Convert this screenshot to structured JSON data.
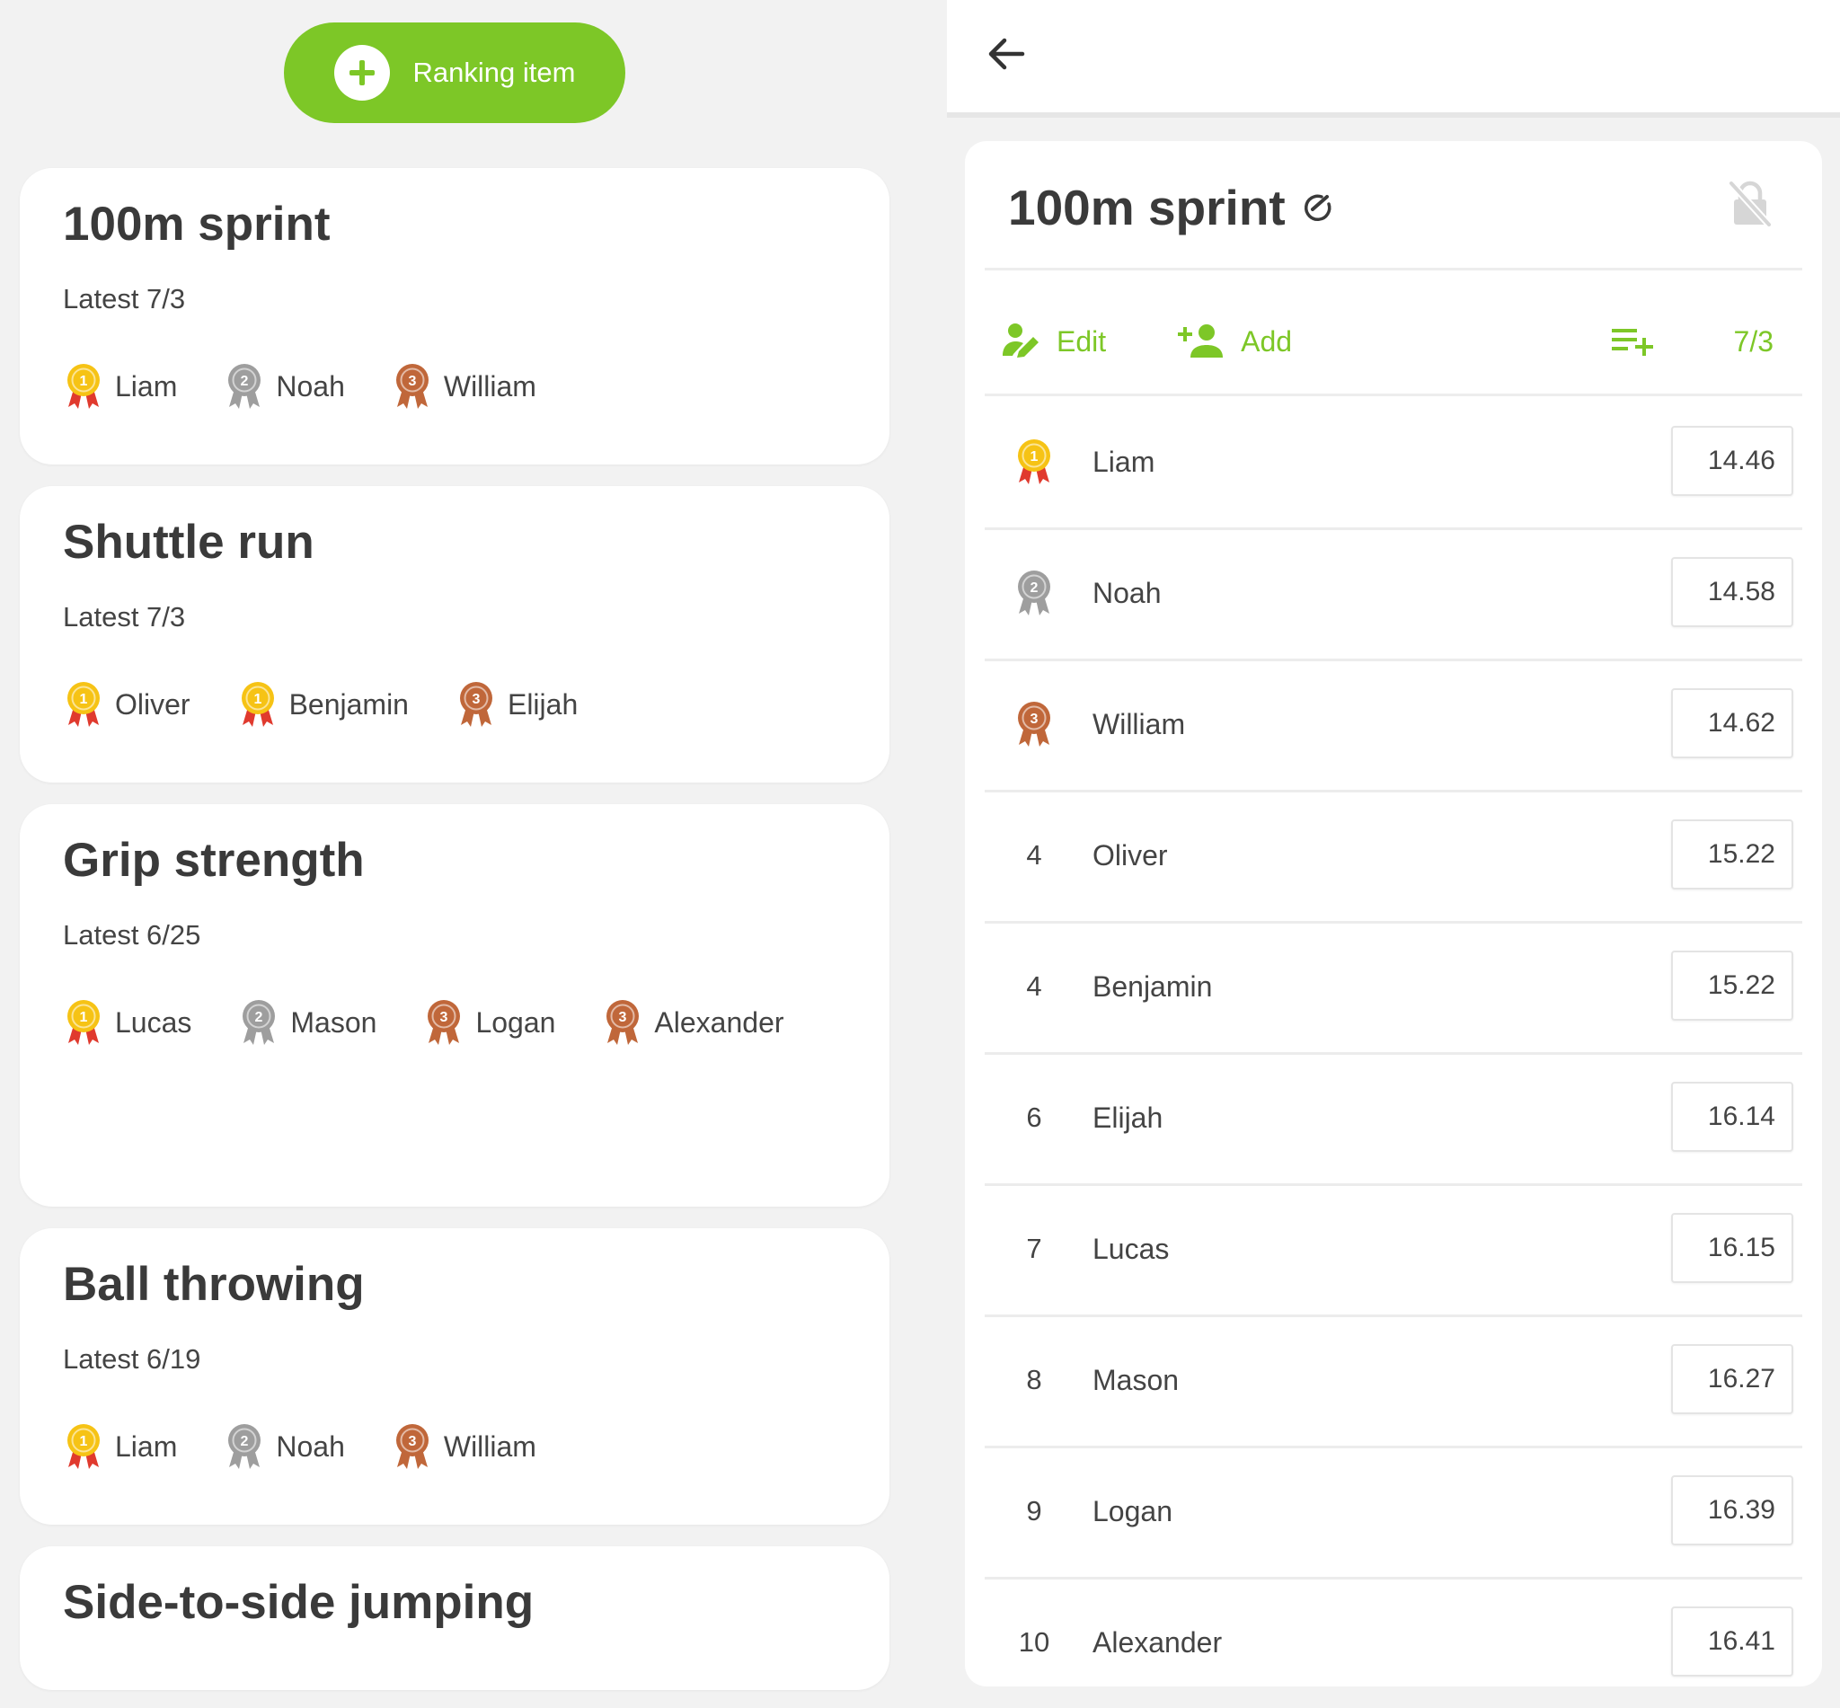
{
  "colors": {
    "accent": "#7dc727",
    "gold": "#f6c315",
    "silver": "#9e9e9e",
    "bronze": "#c0673a"
  },
  "left": {
    "add_button_label": "Ranking item",
    "cards": [
      {
        "title": "100m sprint",
        "latest": "Latest 7/3",
        "winners": [
          {
            "name": "Liam",
            "medal": "1"
          },
          {
            "name": "Noah",
            "medal": "2"
          },
          {
            "name": "William",
            "medal": "3"
          }
        ]
      },
      {
        "title": "Shuttle run",
        "latest": "Latest 7/3",
        "winners": [
          {
            "name": "Oliver",
            "medal": "1"
          },
          {
            "name": "Benjamin",
            "medal": "1"
          },
          {
            "name": "Elijah",
            "medal": "3"
          }
        ]
      },
      {
        "title": "Grip strength",
        "latest": "Latest 6/25",
        "winners": [
          {
            "name": "Lucas",
            "medal": "1"
          },
          {
            "name": "Mason",
            "medal": "2"
          },
          {
            "name": "Logan",
            "medal": "3"
          },
          {
            "name": "Alexander",
            "medal": "3"
          }
        ]
      },
      {
        "title": "Ball throwing",
        "latest": "Latest 6/19",
        "winners": [
          {
            "name": "Liam",
            "medal": "1"
          },
          {
            "name": "Noah",
            "medal": "2"
          },
          {
            "name": "William",
            "medal": "3"
          }
        ]
      },
      {
        "title": "Side-to-side jumping"
      }
    ]
  },
  "right": {
    "title": "100m sprint",
    "toolbar": {
      "edit_label": "Edit",
      "add_label": "Add",
      "date_label": "7/3"
    },
    "rankings": [
      {
        "rank": "1",
        "medal": "1",
        "name": "Liam",
        "score": "14.46"
      },
      {
        "rank": "2",
        "medal": "2",
        "name": "Noah",
        "score": "14.58"
      },
      {
        "rank": "3",
        "medal": "3",
        "name": "William",
        "score": "14.62"
      },
      {
        "rank": "4",
        "name": "Oliver",
        "score": "15.22"
      },
      {
        "rank": "4",
        "name": "Benjamin",
        "score": "15.22"
      },
      {
        "rank": "6",
        "name": "Elijah",
        "score": "16.14"
      },
      {
        "rank": "7",
        "name": "Lucas",
        "score": "16.15"
      },
      {
        "rank": "8",
        "name": "Mason",
        "score": "16.27"
      },
      {
        "rank": "9",
        "name": "Logan",
        "score": "16.39"
      },
      {
        "rank": "10",
        "name": "Alexander",
        "score": "16.41"
      }
    ]
  }
}
